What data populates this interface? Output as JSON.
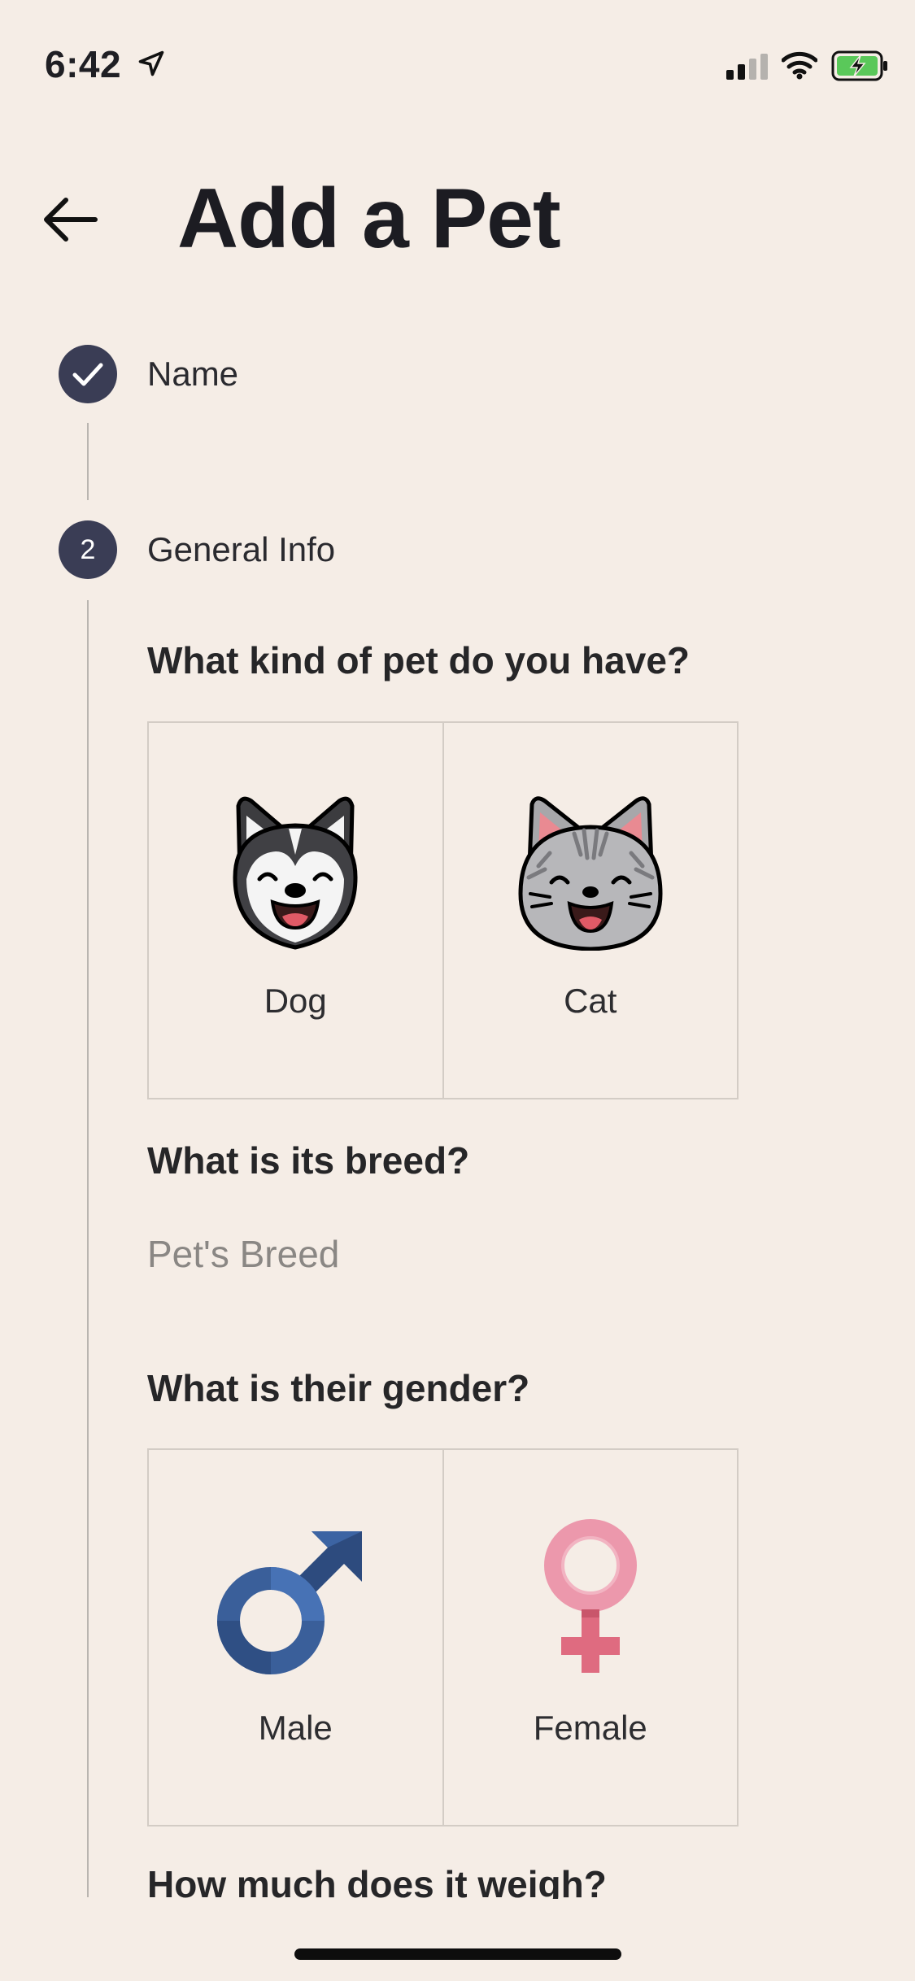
{
  "status": {
    "time": "6:42"
  },
  "header": {
    "title": "Add a Pet"
  },
  "steps": [
    {
      "label": "Name",
      "state": "done"
    },
    {
      "label": "General Info",
      "number": "2",
      "state": "active"
    }
  ],
  "general_info": {
    "pet_kind": {
      "question": "What kind of pet do you have?",
      "options": [
        {
          "label": "Dog",
          "icon": "husky-dog-icon"
        },
        {
          "label": "Cat",
          "icon": "tabby-cat-icon"
        }
      ]
    },
    "breed": {
      "question": "What is its breed?",
      "placeholder": "Pet's Breed",
      "value": ""
    },
    "gender": {
      "question": "What is their gender?",
      "options": [
        {
          "label": "Male",
          "icon": "male-symbol-icon"
        },
        {
          "label": "Female",
          "icon": "female-symbol-icon"
        }
      ]
    },
    "weight": {
      "question": "How much does it weigh?"
    }
  },
  "colors": {
    "background": "#f5ede6",
    "step_circle": "#3a3d55",
    "male": "#3a5f9a",
    "female": "#e98aa2"
  }
}
